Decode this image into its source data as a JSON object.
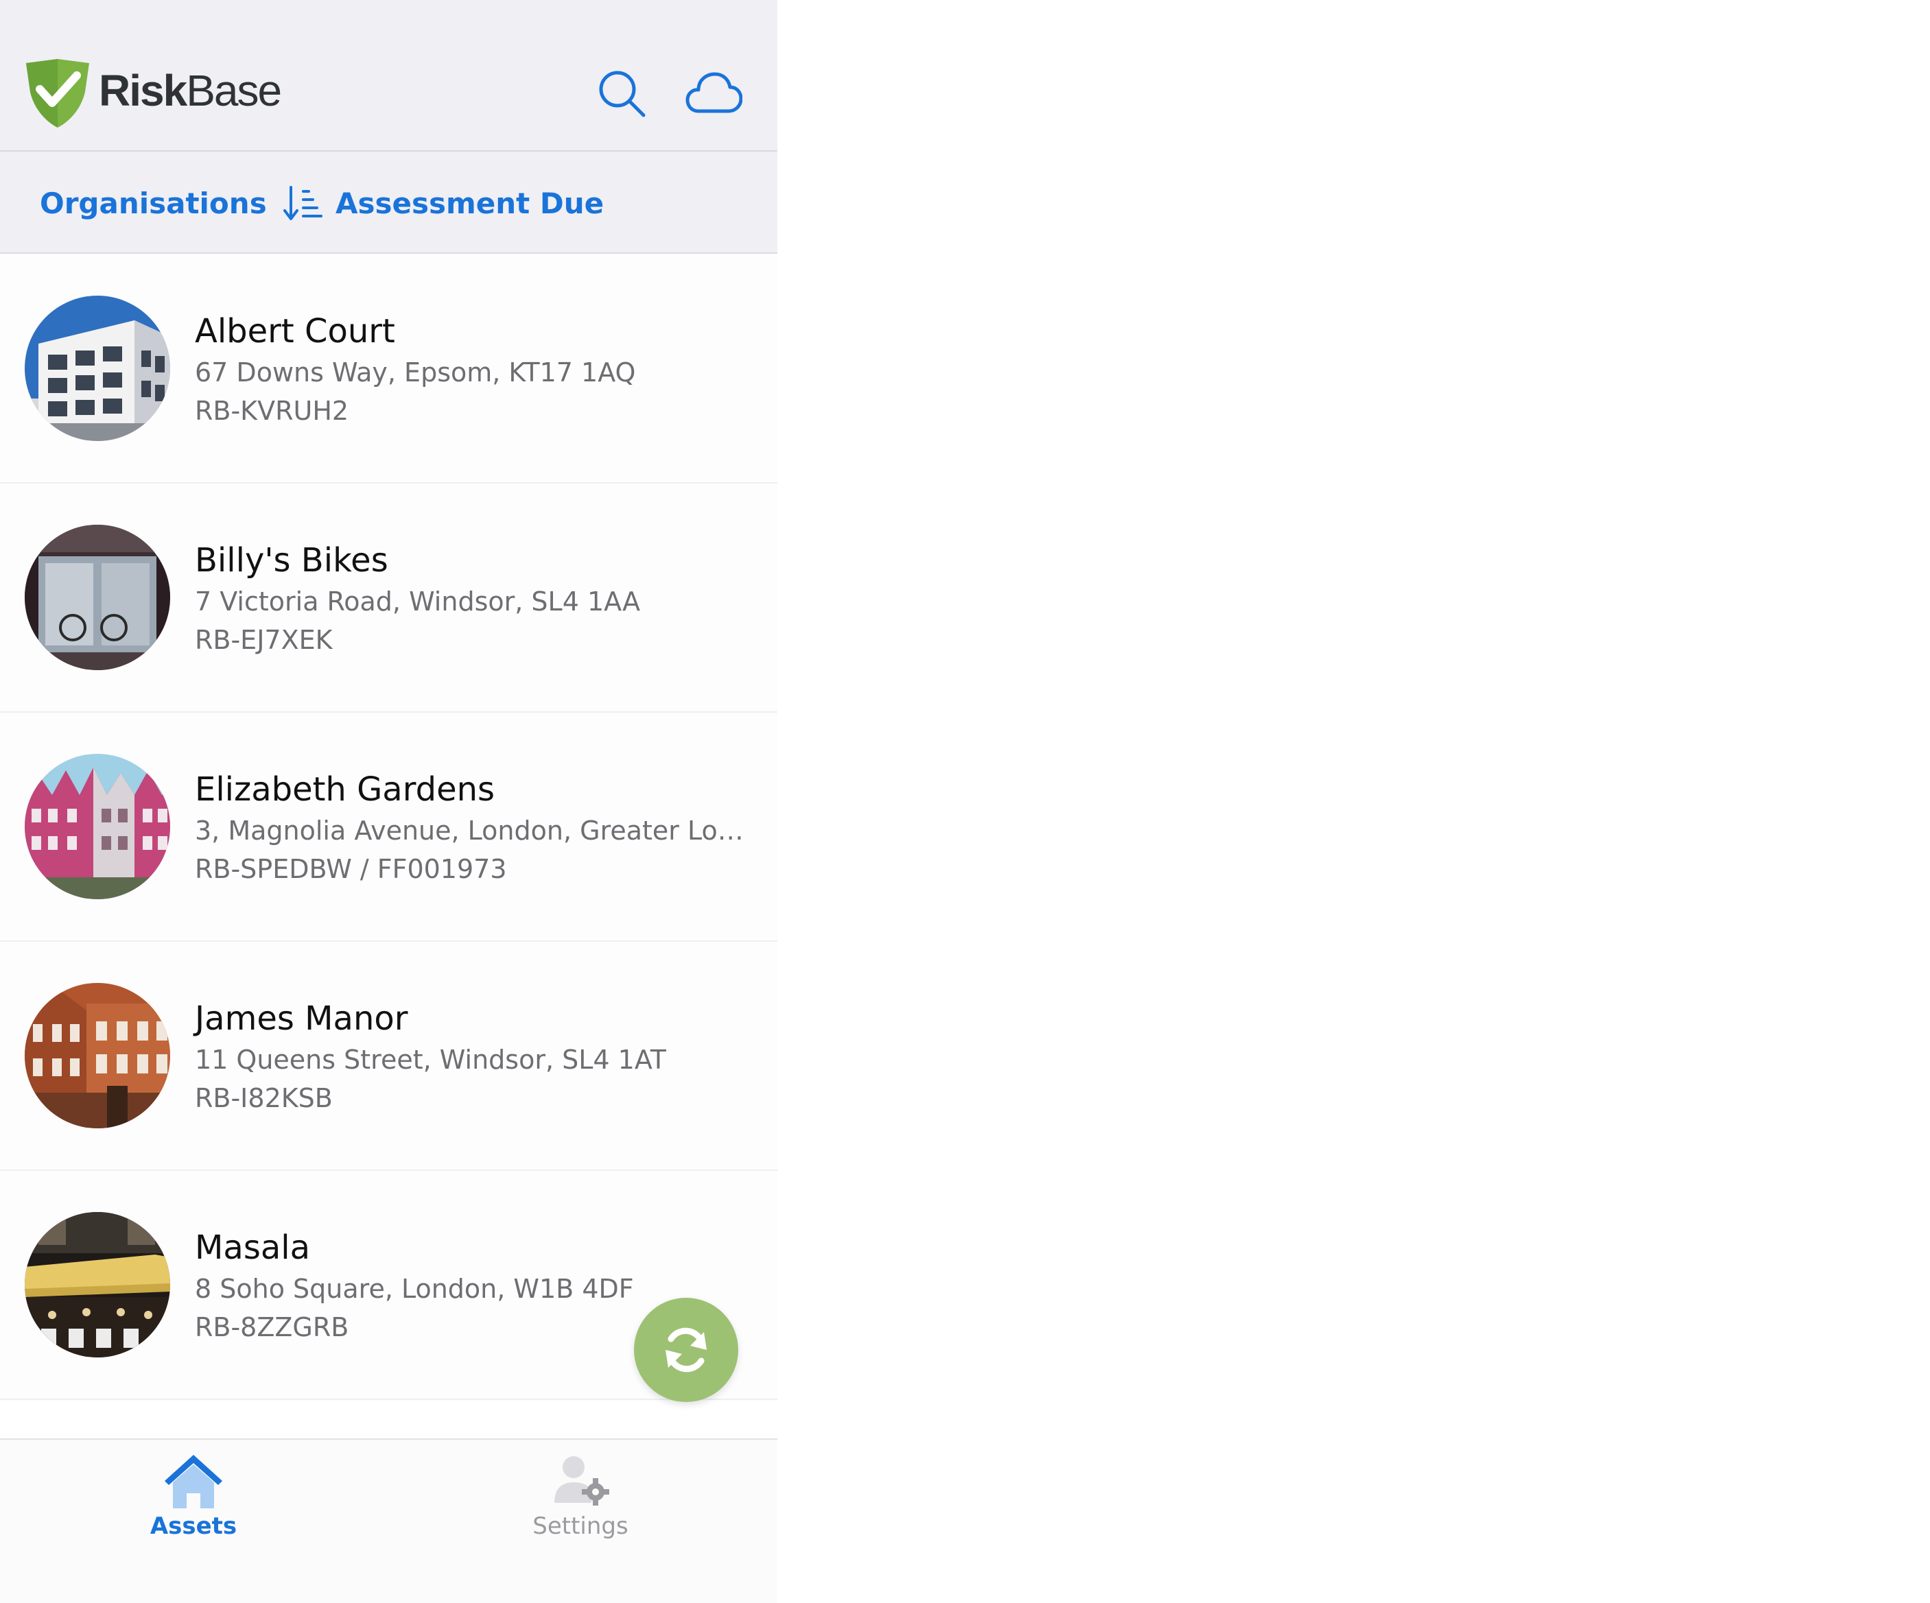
{
  "app": {
    "brand_bold": "Risk",
    "brand_regular": "Base"
  },
  "header": {
    "search_icon": "search-icon",
    "cloud_icon": "cloud-icon"
  },
  "filters": {
    "organisations_label": "Organisations",
    "sort_label": "Assessment Due",
    "sort_icon": "sort-ascending-icon"
  },
  "assets": [
    {
      "name": "Albert Court",
      "address": "67 Downs Way, Epsom, KT17 1AQ",
      "ref": "RB-KVRUH2"
    },
    {
      "name": "Billy's Bikes",
      "address": "7 Victoria Road, Windsor, SL4 1AA",
      "ref": "RB-EJ7XEK"
    },
    {
      "name": "Elizabeth Gardens",
      "address": "3, Magnolia Avenue, London, Greater Lon...",
      "ref": "RB-SPEDBW / FF001973"
    },
    {
      "name": "James Manor",
      "address": "11 Queens Street, Windsor, SL4 1AT",
      "ref": "RB-I82KSB"
    },
    {
      "name": "Masala",
      "address": "8 Soho Square, London, W1B 4DF",
      "ref": "RB-8ZZGRB"
    }
  ],
  "fab": {
    "icon": "sync-icon"
  },
  "tabbar": {
    "assets_label": "Assets",
    "settings_label": "Settings"
  },
  "colors": {
    "accent": "#1a73d9",
    "brand_green": "#7cb342",
    "fab_green": "#9dc173",
    "header_bg": "#efeff4"
  }
}
